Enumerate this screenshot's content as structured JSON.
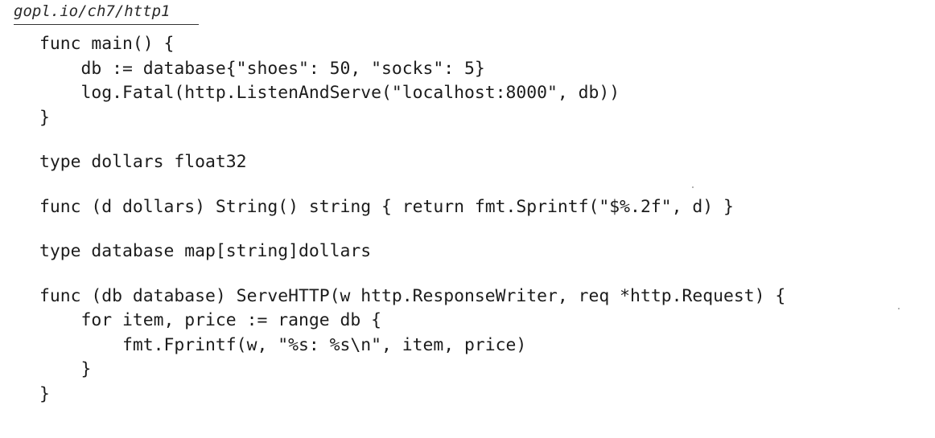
{
  "source_path": "gopl.io/ch7/http1",
  "code": {
    "lines": [
      "func main() {",
      "    db := database{\"shoes\": 50, \"socks\": 5}",
      "    log.Fatal(http.ListenAndServe(\"localhost:8000\", db))",
      "}",
      "",
      "type dollars float32",
      "",
      "func (d dollars) String() string { return fmt.Sprintf(\"$%.2f\", d) }",
      "",
      "type database map[string]dollars",
      "",
      "func (db database) ServeHTTP(w http.ResponseWriter, req *http.Request) {",
      "    for item, price := range db {",
      "        fmt.Fprintf(w, \"%s: %s\\n\", item, price)",
      "    }",
      "}"
    ]
  }
}
